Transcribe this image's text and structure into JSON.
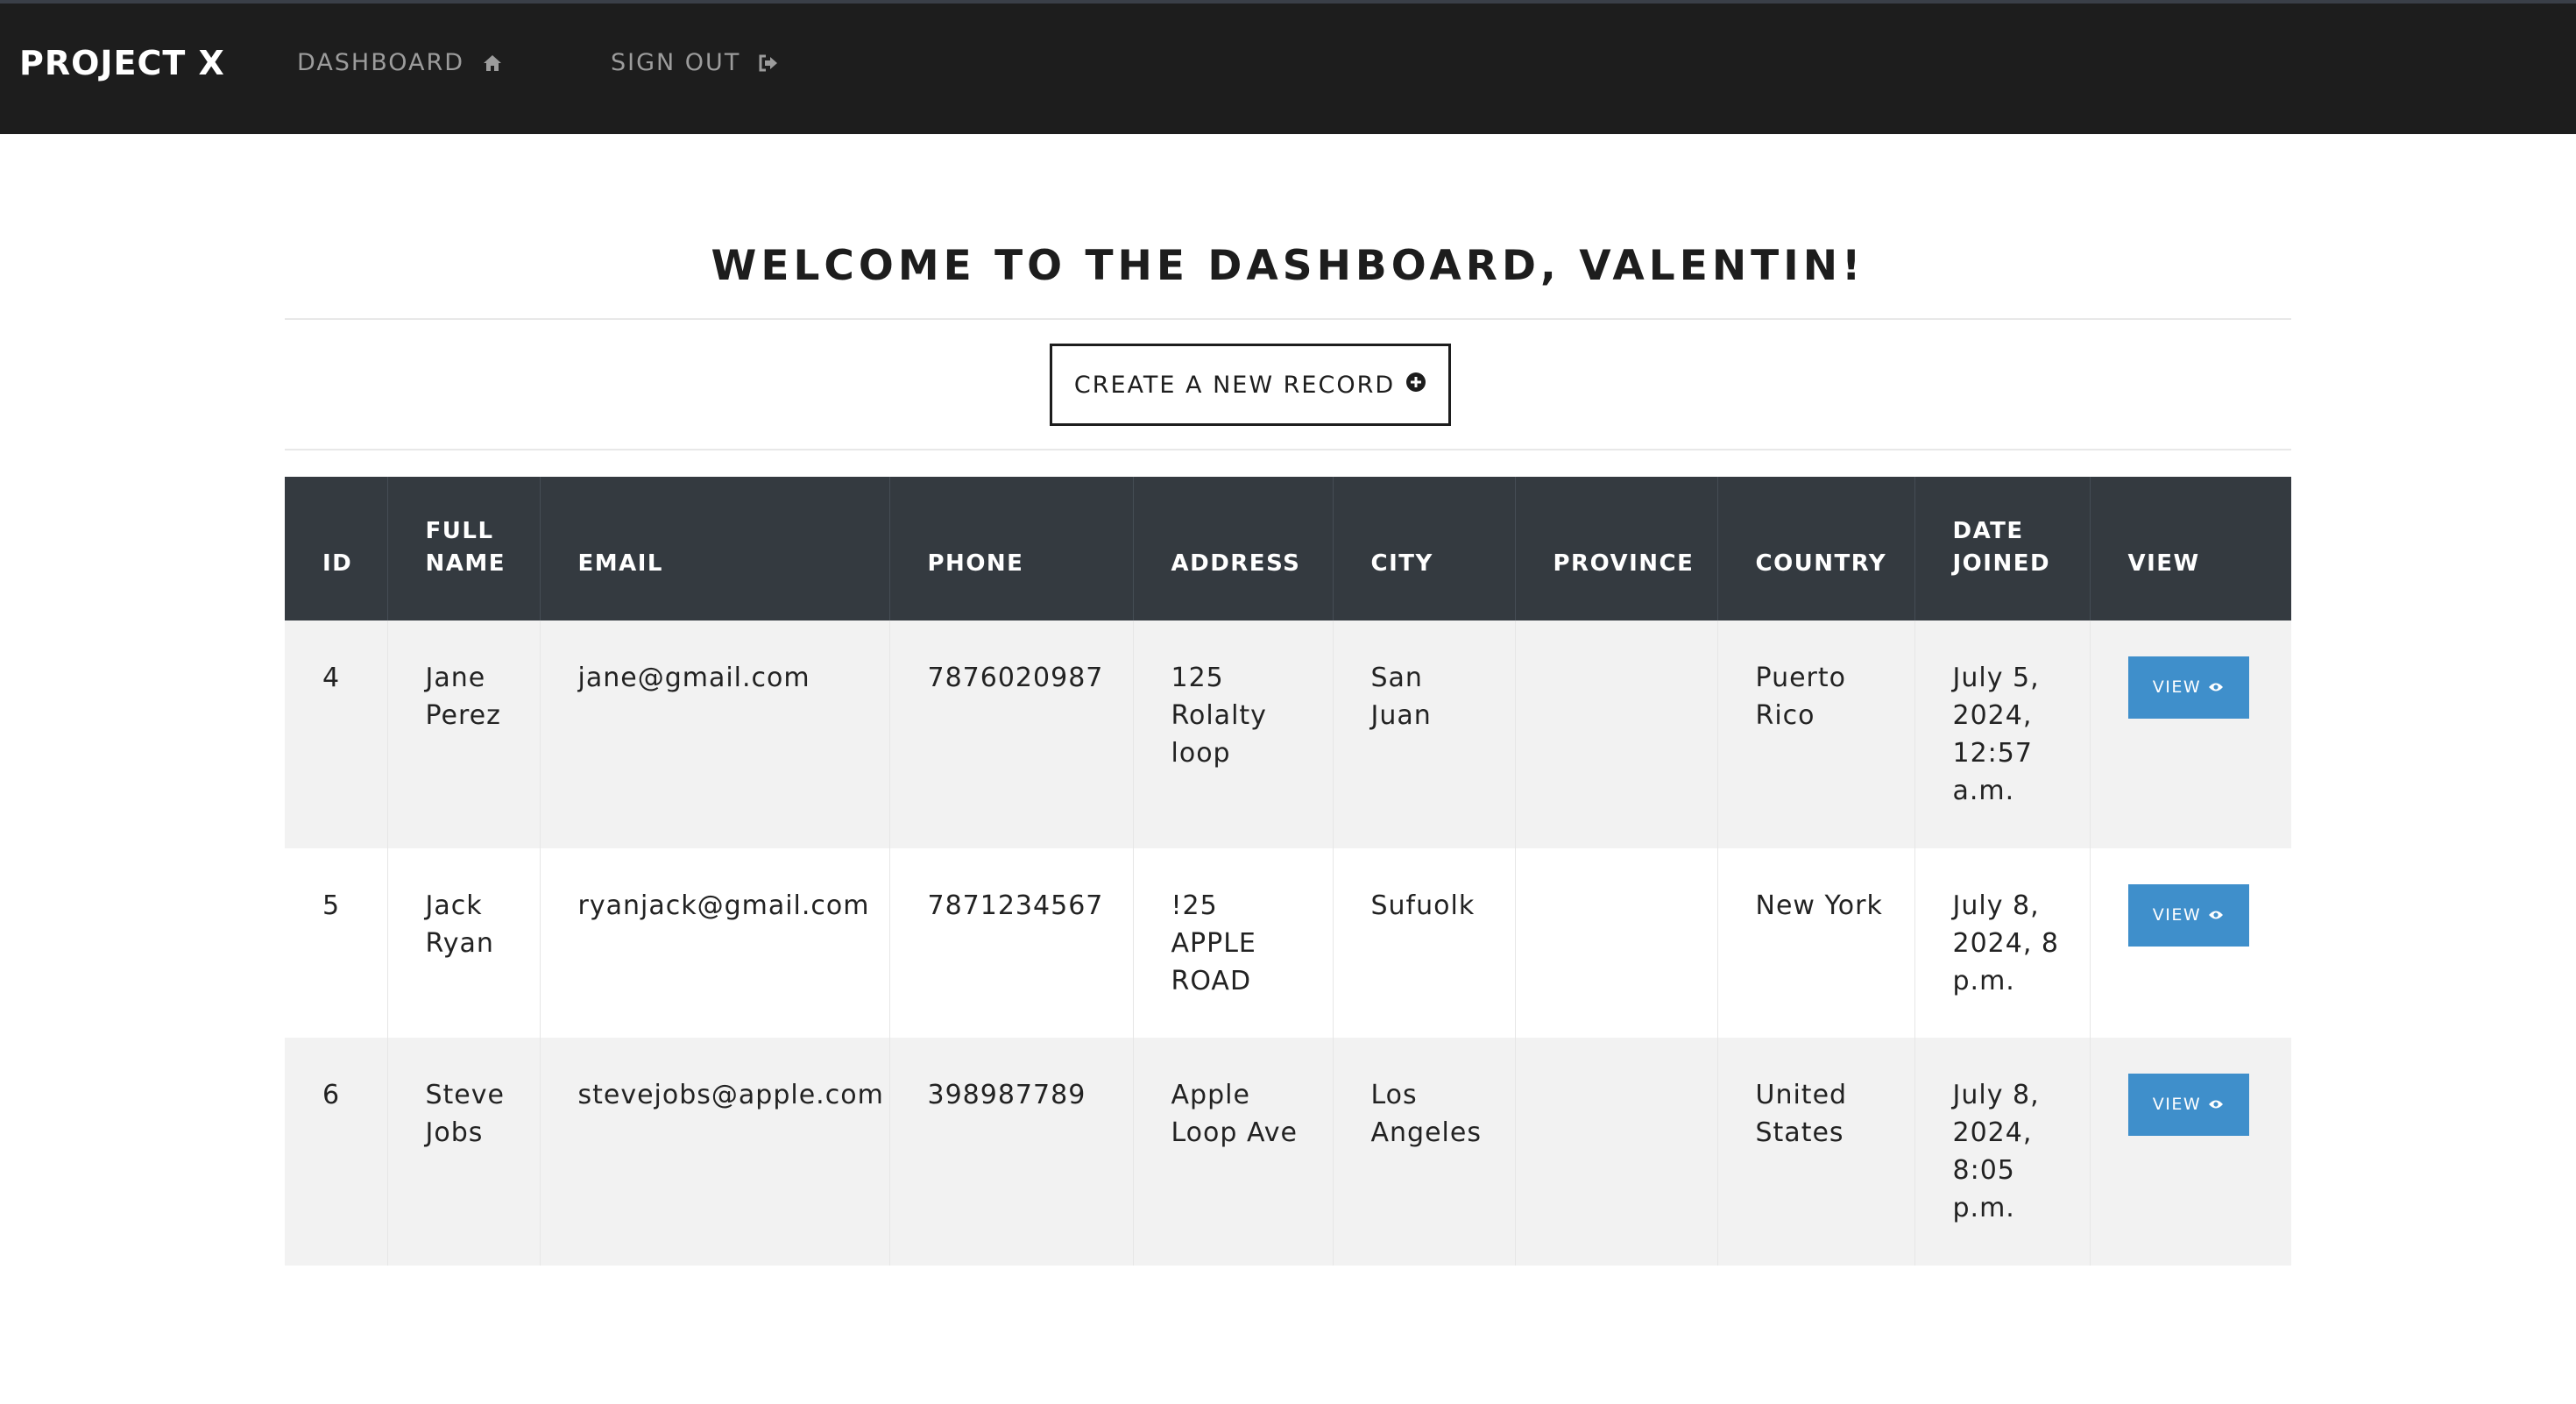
{
  "navbar": {
    "brand": "PROJECT X",
    "dashboard_label": "DASHBOARD",
    "signout_label": "SIGN OUT"
  },
  "main": {
    "welcome": "WELCOME TO THE DASHBOARD, VALENTIN!",
    "create_label": "CREATE A NEW RECORD"
  },
  "table": {
    "headers": {
      "id": "ID",
      "full_name": [
        "FULL",
        "NAME"
      ],
      "email": "EMAIL",
      "phone": "PHONE",
      "address": "ADDRESS",
      "city": "CITY",
      "province": "PROVINCE",
      "country": "COUNTRY",
      "date_joined": [
        "DATE",
        "JOINED"
      ],
      "view": "VIEW"
    },
    "rows": [
      {
        "id": "4",
        "full_name": [
          "Jane",
          "Perez"
        ],
        "email": "jane@gmail.com",
        "phone": "7876020987",
        "address": [
          "125",
          "Rolalty",
          "loop"
        ],
        "city": [
          "San",
          "Juan"
        ],
        "province": "",
        "country": [
          "Puerto",
          "Rico"
        ],
        "date_joined": [
          "July 5,",
          "2024,",
          "12:57",
          "a.m."
        ],
        "view_label": "VIEW"
      },
      {
        "id": "5",
        "full_name": [
          "Jack",
          "Ryan"
        ],
        "email": "ryanjack@gmail.com",
        "phone": "7871234567",
        "address": [
          "!25",
          "APPLE",
          "ROAD"
        ],
        "city": [
          "Sufuolk"
        ],
        "province": "",
        "country": [
          "New York"
        ],
        "date_joined": [
          "July 8,",
          "2024, 8",
          "p.m."
        ],
        "view_label": "VIEW"
      },
      {
        "id": "6",
        "full_name": [
          "Steve",
          "Jobs"
        ],
        "email": "stevejobs@apple.com",
        "phone": "398987789",
        "address": [
          "Apple",
          "Loop Ave"
        ],
        "city": [
          "Los",
          "Angeles"
        ],
        "province": "",
        "country": [
          "United",
          "States"
        ],
        "date_joined": [
          "July 8,",
          "2024,",
          "8:05",
          "p.m."
        ],
        "view_label": "VIEW"
      }
    ]
  },
  "colors": {
    "navbar_bg": "#1d1d1d",
    "table_header_bg": "#343a40",
    "view_button_bg": "#3f8fcb",
    "row_stripe": "#f2f2f2"
  },
  "icons": {
    "dashboard": "home-icon",
    "signout": "sign-out-icon",
    "create": "plus-circle-icon",
    "view": "eye-icon"
  }
}
